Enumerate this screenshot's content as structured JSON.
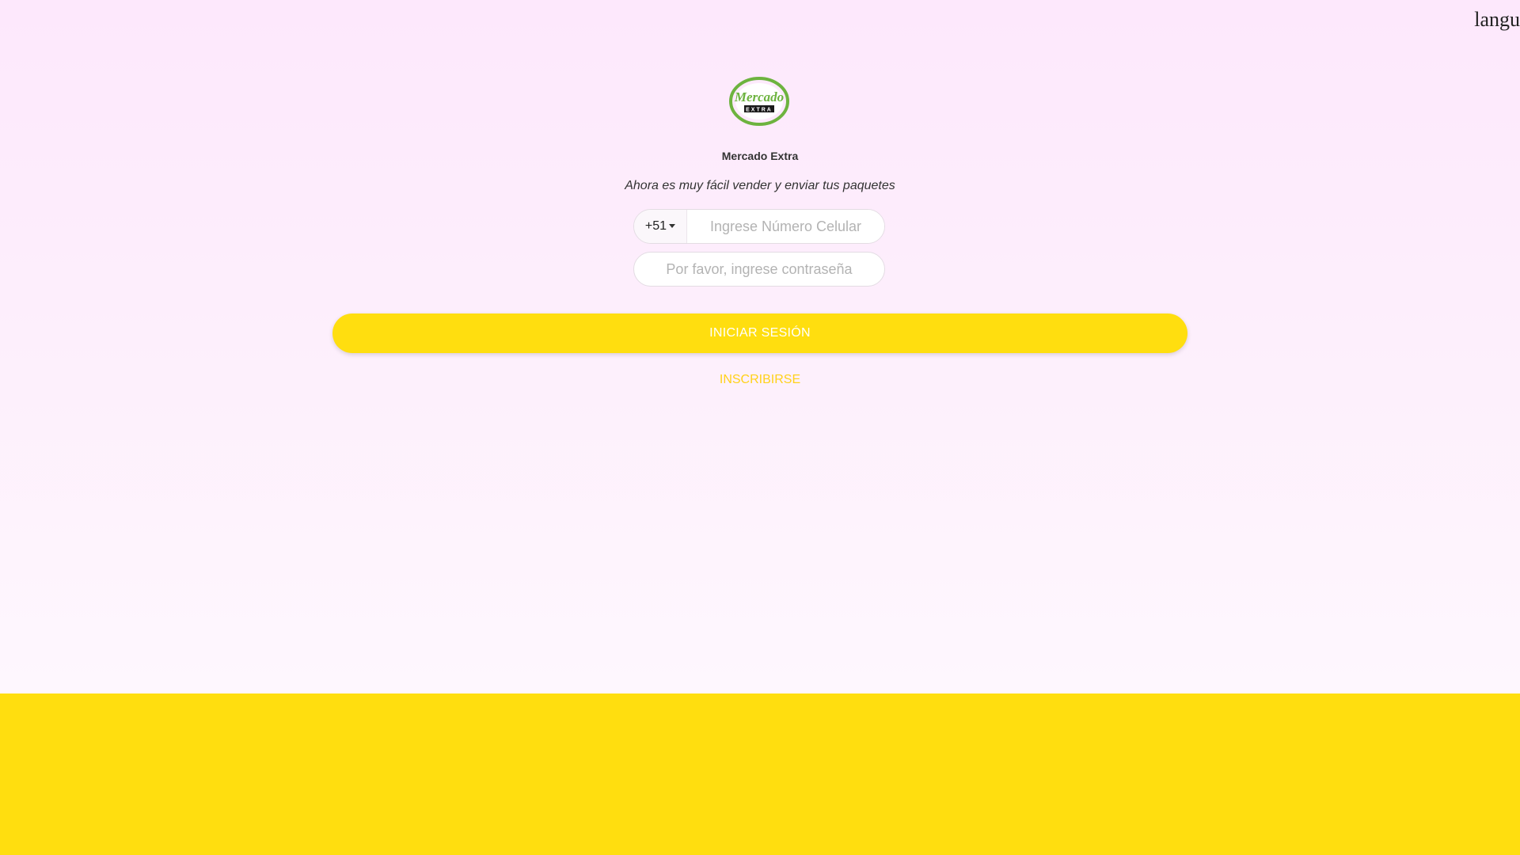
{
  "language": {
    "label": "langu"
  },
  "brand": {
    "name": "Mercado Extra",
    "logo_word": "Mercado",
    "logo_sub": "EXTRA",
    "logo_green": "#6db33f",
    "tagline": "Ahora es muy fácil vender y enviar tus paquetes"
  },
  "login_form": {
    "country_code": "+51",
    "phone_placeholder": "Ingrese Número Celular",
    "phone_value": "",
    "password_placeholder": "Por favor, ingrese contraseña",
    "password_value": "",
    "submit_label": "INICIAR SESIÓN",
    "register_label": "INSCRIBIRSE"
  },
  "colors": {
    "accent": "#ffde0f",
    "background_top": "#fde8fc",
    "register_link": "#ffd21a"
  }
}
